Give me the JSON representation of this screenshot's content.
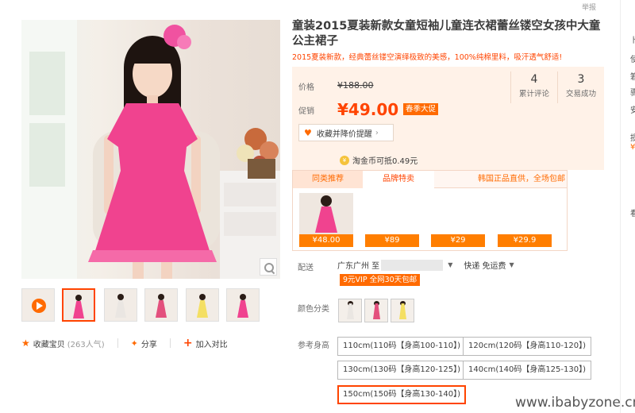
{
  "header": {
    "report_label": "举报"
  },
  "product": {
    "title": "童装2015夏装新款女童短袖儿童连衣裙蕾丝镂空女孩中大童公主裙子",
    "subtitle": "2015夏装新款，经典蕾丝镂空演绎极致的美感，100%纯棉里料，吸汗透气舒适!"
  },
  "price": {
    "price_label": "价格",
    "original_price": "¥188.00",
    "promo_label": "促销",
    "sale_price": "¥49.00",
    "promo_badge": "春季大促",
    "stats": [
      {
        "value": "4",
        "label": "累计评论"
      },
      {
        "value": "3",
        "label": "交易成功"
      }
    ],
    "collect_button": "收藏并降价提醒",
    "coin_text": "淘金币可抵0.49元"
  },
  "recommend": {
    "tabs": [
      "同类推荐",
      "品牌特卖"
    ],
    "note": "韩国正品直供，全场包邮",
    "prices": [
      "¥48.00",
      "¥89",
      "¥29",
      "¥29.9"
    ]
  },
  "shipping": {
    "label": "配送",
    "location": "广东广州 至",
    "method": "快递 免运费",
    "vip_badge": "9元VIP 全网30天包邮"
  },
  "color": {
    "label": "颜色分类",
    "swatches": [
      "white",
      "rose",
      "yellow"
    ]
  },
  "size": {
    "label": "参考身高",
    "options": [
      "110cm(110码【身高100-110】)",
      "120cm(120码【身高110-120】)",
      "130cm(130码【身高120-125】)",
      "140cm(140码【身高125-130】)",
      "150cm(150码【身高130-140】)"
    ],
    "selected": "150cm(150码【身高130-140】)"
  },
  "actions": {
    "collect": "收藏宝贝",
    "collect_count": "(263人气)",
    "share": "分享",
    "compare": "加入对比"
  },
  "side": {
    "chars": [
      "卜",
      "使",
      "箬",
      "骤",
      "安",
      "损",
      "¥",
      "看"
    ]
  },
  "watermark": "www.ibabyzone.cn",
  "colors": {
    "accent": "#ff4400",
    "orange": "#ff6a00",
    "price_bg": "#fff2e8",
    "dress_pink": "#f0438f"
  }
}
